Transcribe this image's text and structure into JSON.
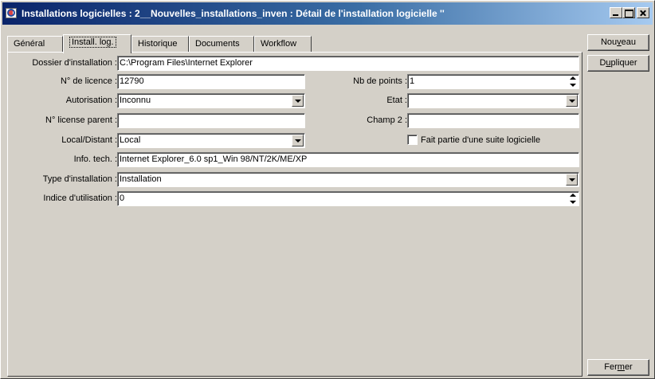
{
  "window": {
    "title": "Installations logicielles : 2__Nouvelles_installations_inven : Détail de l'installation logicielle ''"
  },
  "tabs": [
    {
      "label": "Général",
      "active": false
    },
    {
      "label": "Install. log.",
      "active": true
    },
    {
      "label": "Historique",
      "active": false
    },
    {
      "label": "Documents",
      "active": false
    },
    {
      "label": "Workflow",
      "active": false
    }
  ],
  "form": {
    "dossier": {
      "label": "Dossier d'installation :",
      "value": "C:\\Program Files\\Internet Explorer"
    },
    "licence": {
      "label": "N° de licence :",
      "value": "12790"
    },
    "nb_points": {
      "label": "Nb de points :",
      "value": "1"
    },
    "autorisation": {
      "label": "Autorisation :",
      "value": "Inconnu"
    },
    "etat": {
      "label": "Etat :",
      "value": ""
    },
    "license_parent": {
      "label": "N° license parent :",
      "value": ""
    },
    "champ2": {
      "label": "Champ 2 :",
      "value": ""
    },
    "local_distant": {
      "label": "Local/Distant :",
      "value": "Local"
    },
    "suite": {
      "label": "Fait partie d'une suite logicielle",
      "checked": false
    },
    "info_tech": {
      "label": "Info. tech. :",
      "value": "Internet Explorer_6.0 sp1_Win 98/NT/2K/ME/XP"
    },
    "type_install": {
      "label": "Type d'installation :",
      "value": "Installation"
    },
    "indice": {
      "label": "Indice d'utilisation :",
      "value": "0"
    }
  },
  "buttons": {
    "nouveau": {
      "before": "Nou",
      "mnemonic": "v",
      "after": "eau"
    },
    "dupliquer": {
      "before": "D",
      "mnemonic": "u",
      "after": "pliquer"
    },
    "fermer": {
      "before": "Fer",
      "mnemonic": "m",
      "after": "er"
    }
  }
}
